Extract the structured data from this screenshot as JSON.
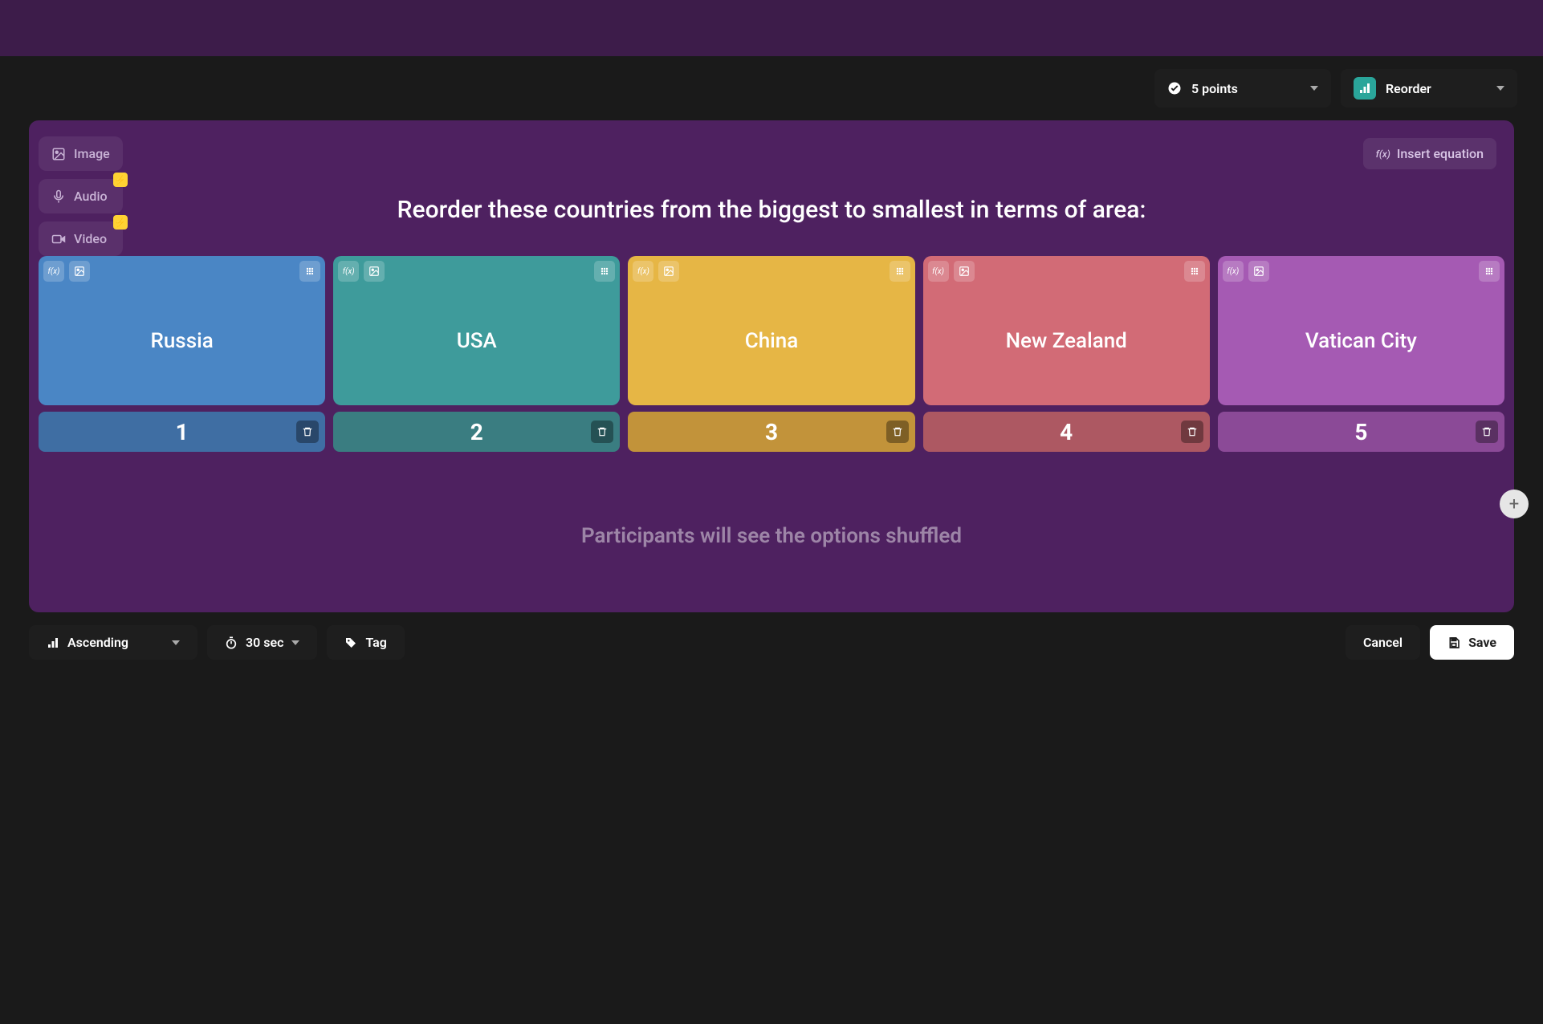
{
  "toolbar": {
    "points_label": "5 points",
    "question_type_label": "Reorder"
  },
  "media": {
    "image_label": "Image",
    "audio_label": "Audio",
    "video_label": "Video"
  },
  "equation_btn": "Insert equation",
  "question": "Reorder these countries from the biggest to smallest in terms of area:",
  "cards": [
    {
      "label": "Russia",
      "index": "1"
    },
    {
      "label": "USA",
      "index": "2"
    },
    {
      "label": "China",
      "index": "3"
    },
    {
      "label": "New Zealand",
      "index": "4"
    },
    {
      "label": "Vatican City",
      "index": "5"
    }
  ],
  "hint": "Participants will see the options shuffled",
  "bottom": {
    "order_label": "Ascending",
    "time_label": "30 sec",
    "tag_label": "Tag",
    "cancel_label": "Cancel",
    "save_label": "Save"
  }
}
